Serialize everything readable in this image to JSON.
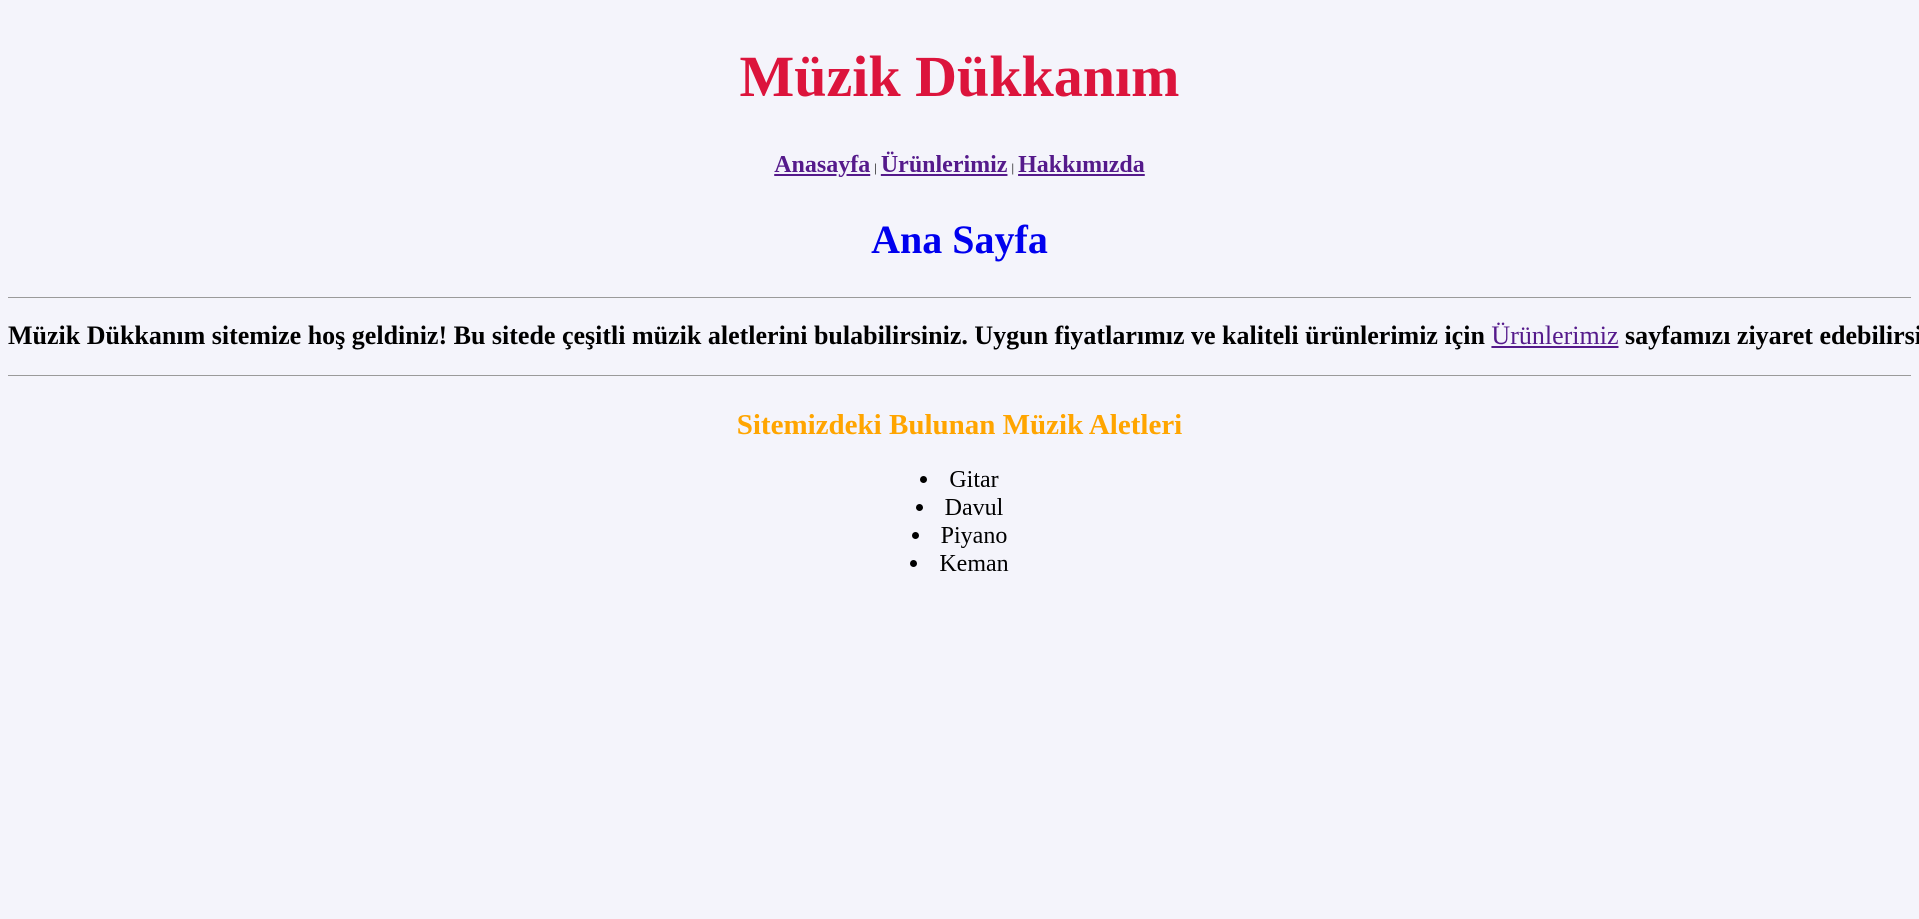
{
  "header": {
    "site_title": "Müzik Dükkanım"
  },
  "nav": {
    "items": [
      {
        "label": "Anasayfa"
      },
      {
        "label": "Ürünlerimiz"
      },
      {
        "label": "Hakkımızda"
      }
    ],
    "separator": "|"
  },
  "main": {
    "page_heading": "Ana Sayfa",
    "intro_before_link": "Müzik Dükkanım sitemize hoş geldiniz! Bu sitede çeşitli müzik aletlerini bulabilirsiniz. Uygun fiyatlarımız ve kaliteli ürünlerimiz için ",
    "intro_link": "Ürünlerimiz",
    "intro_after_link": " sayfamızı ziyaret edebilirsiniz.",
    "section_heading": "Sitemizdeki Bulunan Müzik Aletleri",
    "instruments": [
      "Gitar",
      "Davul",
      "Piyano",
      "Keman"
    ]
  },
  "colors": {
    "background": "#f4f4fb",
    "site_title": "#dc143c",
    "page_heading": "#0000ee",
    "section_heading": "#ffa500",
    "visited_link": "#551a8b"
  }
}
